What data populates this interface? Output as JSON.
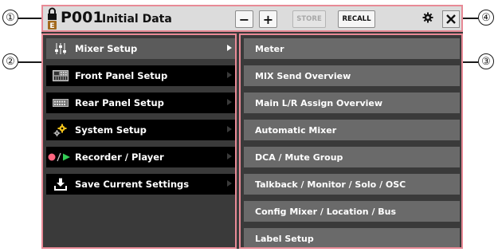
{
  "callouts": [
    "①",
    "②",
    "③",
    "④"
  ],
  "titlebar": {
    "lock_icon": "lock-with-e-icon",
    "lock_letter": "E",
    "preset_number": "P001",
    "preset_name": "Initial Data",
    "minus_label": "−",
    "plus_label": "+",
    "store_label": "STORE",
    "recall_label": "RECALL",
    "settings_icon": "gear-icon",
    "close_icon": "close-icon"
  },
  "menu": {
    "items": [
      {
        "label": "Mixer Setup",
        "icon": "mixer-faders-icon",
        "selected": true
      },
      {
        "label": "Front Panel Setup",
        "icon": "front-panel-icon",
        "selected": false
      },
      {
        "label": "Rear Panel Setup",
        "icon": "rear-panel-icon",
        "selected": false
      },
      {
        "label": "System Setup",
        "icon": "gears-icon",
        "selected": false
      },
      {
        "label": "Recorder / Player",
        "icon": "record-play-icon",
        "selected": false
      },
      {
        "label": "Save Current Settings",
        "icon": "save-download-icon",
        "selected": false
      }
    ]
  },
  "submenu": {
    "items": [
      "Meter",
      "MIX Send Overview",
      "Main L/R Assign Overview",
      "Automatic Mixer",
      "DCA / Mute Group",
      "Talkback / Monitor / Solo / OSC",
      "Config Mixer / Location / Bus",
      "Label Setup"
    ]
  },
  "colors": {
    "highlight_border": "#e88a96",
    "record_dot": "#ff6680",
    "play_triangle": "#33cc55",
    "gear_yellow": "#f2c21b"
  }
}
